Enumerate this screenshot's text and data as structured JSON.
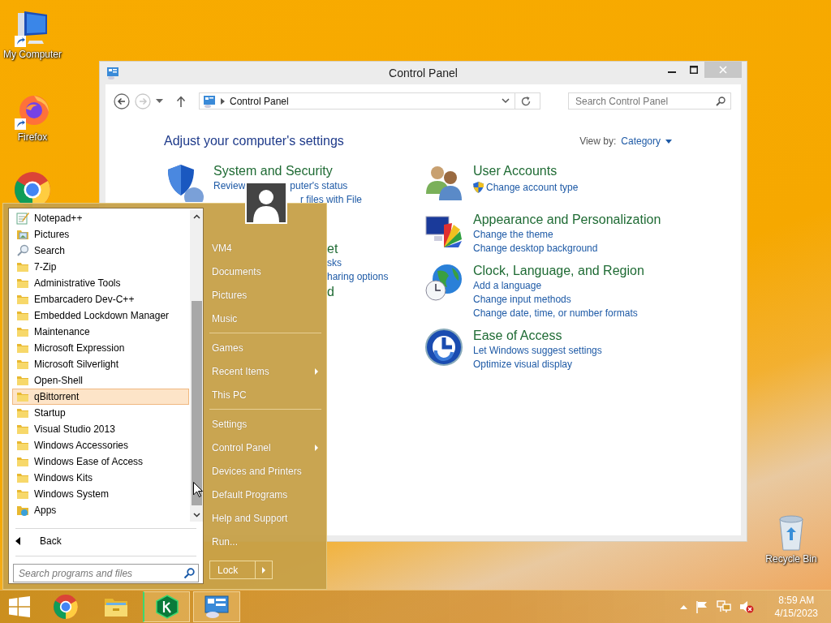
{
  "desktop_icons": [
    {
      "kind": "computer",
      "label": "My Computer"
    },
    {
      "kind": "firefox",
      "label": "Firefox"
    },
    {
      "kind": "chrome"
    },
    {
      "kind": "recycle_bin",
      "label": "Recycle Bin"
    }
  ],
  "window": {
    "title": "Control Panel",
    "address": "Control Panel",
    "search": {
      "placeholder": "Search Control Panel"
    },
    "heading": "Adjust your computer's settings",
    "view_by": {
      "label": "View by:",
      "value": "Category"
    },
    "covered_category": {
      "kind": "shield",
      "title": "System and Security",
      "link_start": "Review",
      "link_end": "puter's status",
      "link_tail": "r files with File",
      "tails": [
        {
          "kind": "heading",
          "text": "et"
        },
        {
          "kind": "link",
          "text": "sks"
        },
        {
          "kind": "link",
          "text": "haring options"
        },
        {
          "kind": "heading",
          "text": "d"
        }
      ]
    },
    "categories": [
      {
        "kind": "users",
        "title": "User Accounts",
        "links": [
          {
            "text": "Change account type",
            "shield": true
          }
        ]
      },
      {
        "kind": "appearance",
        "title": "Appearance and Personalization",
        "links": [
          {
            "text": "Change the theme",
            "shield": false
          },
          {
            "text": "Change desktop background",
            "shield": false
          }
        ]
      },
      {
        "kind": "clock",
        "title": "Clock, Language, and Region",
        "links": [
          {
            "text": "Add a language",
            "shield": false
          },
          {
            "text": "Change input methods",
            "shield": false
          },
          {
            "text": "Change date, time, or number formats",
            "shield": false
          }
        ]
      },
      {
        "kind": "access",
        "title": "Ease of Access",
        "links": [
          {
            "text": "Let Windows suggest settings",
            "shield": false
          },
          {
            "text": "Optimize visual display",
            "shield": false
          }
        ]
      }
    ]
  },
  "start_menu": {
    "programs": [
      {
        "kind": "notepad",
        "label": "Notepad++",
        "selected": false
      },
      {
        "kind": "pictures",
        "label": "Pictures",
        "selected": false
      },
      {
        "kind": "search",
        "label": "Search",
        "selected": false
      },
      {
        "kind": "folder",
        "label": "7-Zip",
        "selected": false
      },
      {
        "kind": "folder",
        "label": "Administrative Tools",
        "selected": false
      },
      {
        "kind": "folder",
        "label": "Embarcadero Dev-C++",
        "selected": false
      },
      {
        "kind": "folder",
        "label": "Embedded Lockdown Manager",
        "selected": false
      },
      {
        "kind": "folder",
        "label": "Maintenance",
        "selected": false
      },
      {
        "kind": "folder",
        "label": "Microsoft Expression",
        "selected": false
      },
      {
        "kind": "folder",
        "label": "Microsoft Silverlight",
        "selected": false
      },
      {
        "kind": "folder",
        "label": "Open-Shell",
        "selected": false
      },
      {
        "kind": "folder",
        "label": "qBittorrent",
        "selected": true
      },
      {
        "kind": "folder",
        "label": "Startup",
        "selected": false
      },
      {
        "kind": "folder",
        "label": "Visual Studio 2013",
        "selected": false
      },
      {
        "kind": "folder",
        "label": "Windows Accessories",
        "selected": false
      },
      {
        "kind": "folder",
        "label": "Windows Ease of Access",
        "selected": false
      },
      {
        "kind": "folder",
        "label": "Windows Kits",
        "selected": false
      },
      {
        "kind": "folder",
        "label": "Windows System",
        "selected": false
      },
      {
        "kind": "apps",
        "label": "Apps",
        "selected": false
      }
    ],
    "back": "Back",
    "search": {
      "placeholder": "Search programs and files"
    },
    "places": [
      [
        {
          "label": "VM4",
          "submenu": false
        },
        {
          "label": "Documents",
          "submenu": false
        },
        {
          "label": "Pictures",
          "submenu": false
        },
        {
          "label": "Music",
          "submenu": false
        }
      ],
      [
        {
          "label": "Games",
          "submenu": false
        },
        {
          "label": "Recent Items",
          "submenu": true
        },
        {
          "label": "This PC",
          "submenu": false
        }
      ],
      [
        {
          "label": "Settings",
          "submenu": false
        },
        {
          "label": "Control Panel",
          "submenu": true
        },
        {
          "label": "Devices and Printers",
          "submenu": false
        },
        {
          "label": "Default Programs",
          "submenu": false
        },
        {
          "label": "Help and Support",
          "submenu": false
        },
        {
          "label": "Run...",
          "submenu": false
        }
      ]
    ],
    "lock": "Lock"
  },
  "taskbar": {
    "apps": [
      {
        "kind": "start",
        "active": false
      },
      {
        "kind": "chrome",
        "active": false
      },
      {
        "kind": "explorer",
        "active": false
      },
      {
        "kind": "kaspersky",
        "active": true
      },
      {
        "kind": "control_panel",
        "active": true
      }
    ],
    "tray": [
      {
        "kind": "caret"
      },
      {
        "kind": "flag"
      },
      {
        "kind": "network"
      },
      {
        "kind": "speaker_muted"
      }
    ],
    "time": "8:59 AM",
    "date": "4/15/2023"
  }
}
